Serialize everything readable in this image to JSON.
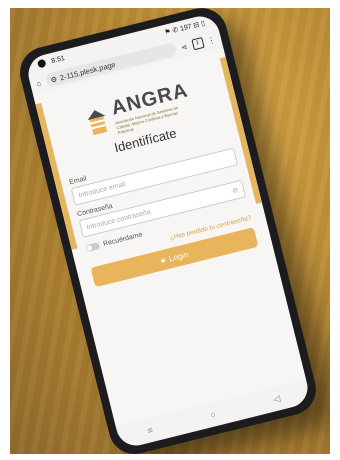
{
  "status": {
    "time": "8:51",
    "right": "⚑ ✆ 197 ⊟ ▯"
  },
  "browser": {
    "url": "2-115.plesk.page",
    "tabs": "1"
  },
  "logo": {
    "name": "ANGRA",
    "subtitle": "Asociación Nacional de Gestores de Calidad, Mejora Continua y Buenas Prácticas"
  },
  "login": {
    "title": "Identifícate",
    "email_label": "Email",
    "email_placeholder": "Introduce email",
    "password_label": "Contraseña",
    "password_placeholder": "Introduce contraseña",
    "remember_label": "Recuérdame",
    "forgot_link": "¿Has perdido tu contraseña?",
    "button_label": "Login"
  },
  "colors": {
    "accent": "#e8b45c",
    "wood": "#c89638"
  }
}
